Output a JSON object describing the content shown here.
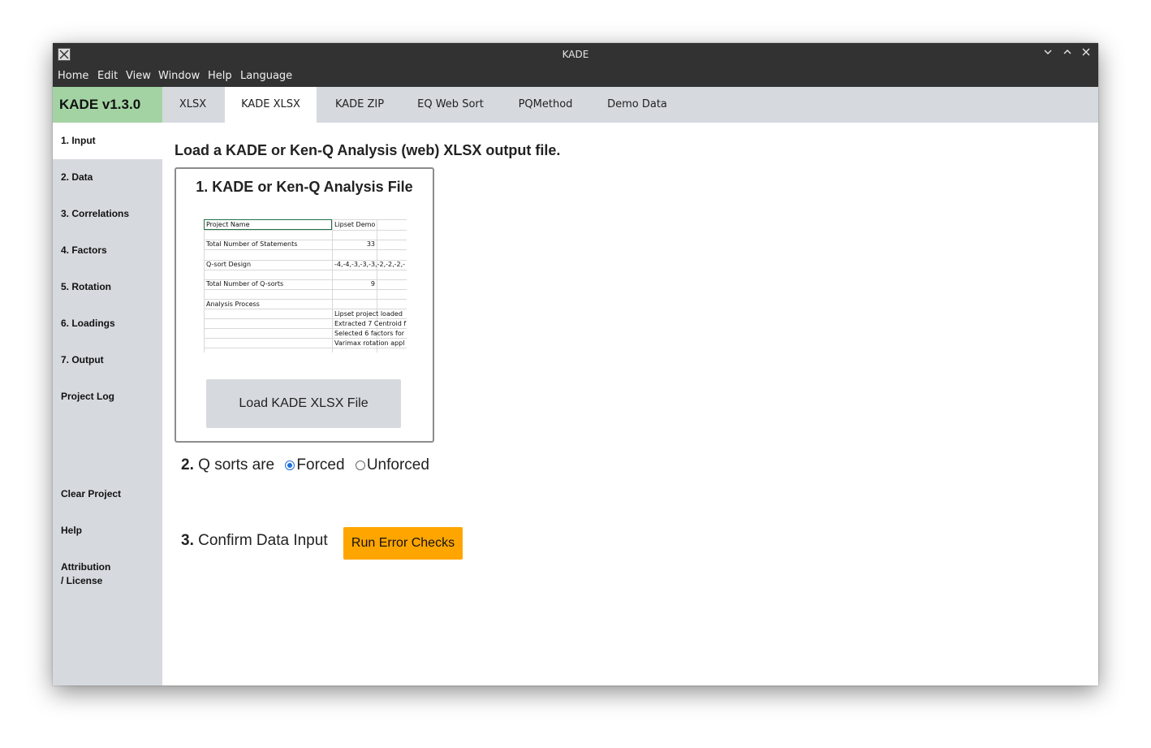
{
  "window": {
    "title": "KADE"
  },
  "menubar": {
    "items": [
      "Home",
      "Edit",
      "View",
      "Window",
      "Help",
      "Language"
    ]
  },
  "brand": {
    "label": "KADE v1.3.0",
    "color": "#a3d3a3"
  },
  "tabs": [
    {
      "label": "XLSX"
    },
    {
      "label": "KADE XLSX",
      "active": true
    },
    {
      "label": "KADE ZIP"
    },
    {
      "label": "EQ Web Sort"
    },
    {
      "label": "PQMethod"
    },
    {
      "label": "Demo Data"
    }
  ],
  "sidebar": {
    "items": [
      {
        "label": "1. Input",
        "active": true
      },
      {
        "label": "2. Data"
      },
      {
        "label": "3. Correlations"
      },
      {
        "label": "4. Factors"
      },
      {
        "label": "5. Rotation"
      },
      {
        "label": "6. Loadings"
      },
      {
        "label": "7. Output"
      },
      {
        "label": "Project Log"
      }
    ],
    "bottom_items": [
      {
        "label": "Clear Project"
      },
      {
        "label": "Help"
      },
      {
        "label": "Attribution"
      },
      {
        "label": "/ License"
      }
    ]
  },
  "main": {
    "heading": "Load a KADE or Ken-Q Analysis (web) XLSX output file.",
    "card": {
      "title": "1. KADE or Ken-Q Analysis File",
      "preview_rows": [
        {
          "label": "Project Name",
          "value": "Lipset Demo"
        },
        {
          "label": "Total Number of Statements",
          "value": "33"
        },
        {
          "label": "Q-sort Design",
          "value": "-4,-4,-3,-3,-3,-2,-2,-2,-"
        },
        {
          "label": "Total Number of Q-sorts",
          "value": "9"
        },
        {
          "label": "Analysis Process",
          "value": ""
        }
      ],
      "process_lines": [
        "Lipset project loaded",
        "Extracted 7 Centroid f",
        "Selected 6 factors for",
        "Varimax rotation appl"
      ],
      "load_button": "Load KADE XLSX File"
    },
    "step2": {
      "number": "2.",
      "label": "Q sorts are",
      "options": [
        {
          "label": "Forced",
          "selected": true
        },
        {
          "label": "Unforced",
          "selected": false
        }
      ]
    },
    "step3": {
      "number": "3.",
      "label": "Confirm Data Input",
      "button": "Run Error Checks",
      "button_color": "#ffa500"
    }
  }
}
